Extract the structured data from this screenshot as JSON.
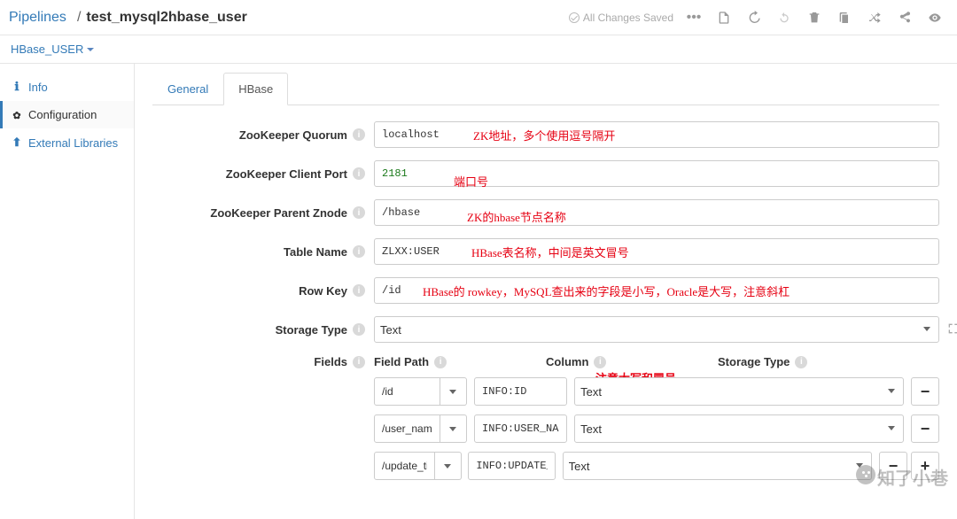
{
  "header": {
    "pipelines": "Pipelines",
    "name": "test_mysql2hbase_user",
    "saved": "All Changes Saved"
  },
  "subheader": {
    "stage": "HBase_USER"
  },
  "sidebar": {
    "info": "Info",
    "conf": "Configuration",
    "ext": "External Libraries"
  },
  "tabs": {
    "general": "General",
    "hbase": "HBase"
  },
  "form": {
    "zk_quorum": {
      "label": "ZooKeeper Quorum",
      "value": "localhost",
      "note": "ZK地址，多个使用逗号隔开"
    },
    "zk_port": {
      "label": "ZooKeeper Client Port",
      "value": "2181",
      "note": "端口号"
    },
    "zk_parent": {
      "label": "ZooKeeper Parent Znode",
      "value": "/hbase",
      "note": "ZK的hbase节点名称"
    },
    "table": {
      "label": "Table Name",
      "value": "ZLXX:USER",
      "note": "HBase表名称，中间是英文冒号"
    },
    "rowkey": {
      "label": "Row Key",
      "value": "/id",
      "note": "HBase的 rowkey，MySQL查出来的字段是小写，Oracle是大写，注意斜杠"
    },
    "storage": {
      "label": "Storage Type",
      "value": "Text"
    },
    "fields_lbl": "Fields",
    "cols": {
      "path": "Field Path",
      "column": "Column",
      "storage": "Storage Type",
      "note": "注意大写和冒号"
    },
    "rows": [
      {
        "path": "/id",
        "column": "INFO:ID",
        "storage": "Text"
      },
      {
        "path": "/user_name",
        "column": "INFO:USER_NAME",
        "storage": "Text"
      },
      {
        "path": "/update_time",
        "column": "INFO:UPDATE_TIME",
        "storage": "Text"
      }
    ]
  },
  "watermark": "知了小巷"
}
